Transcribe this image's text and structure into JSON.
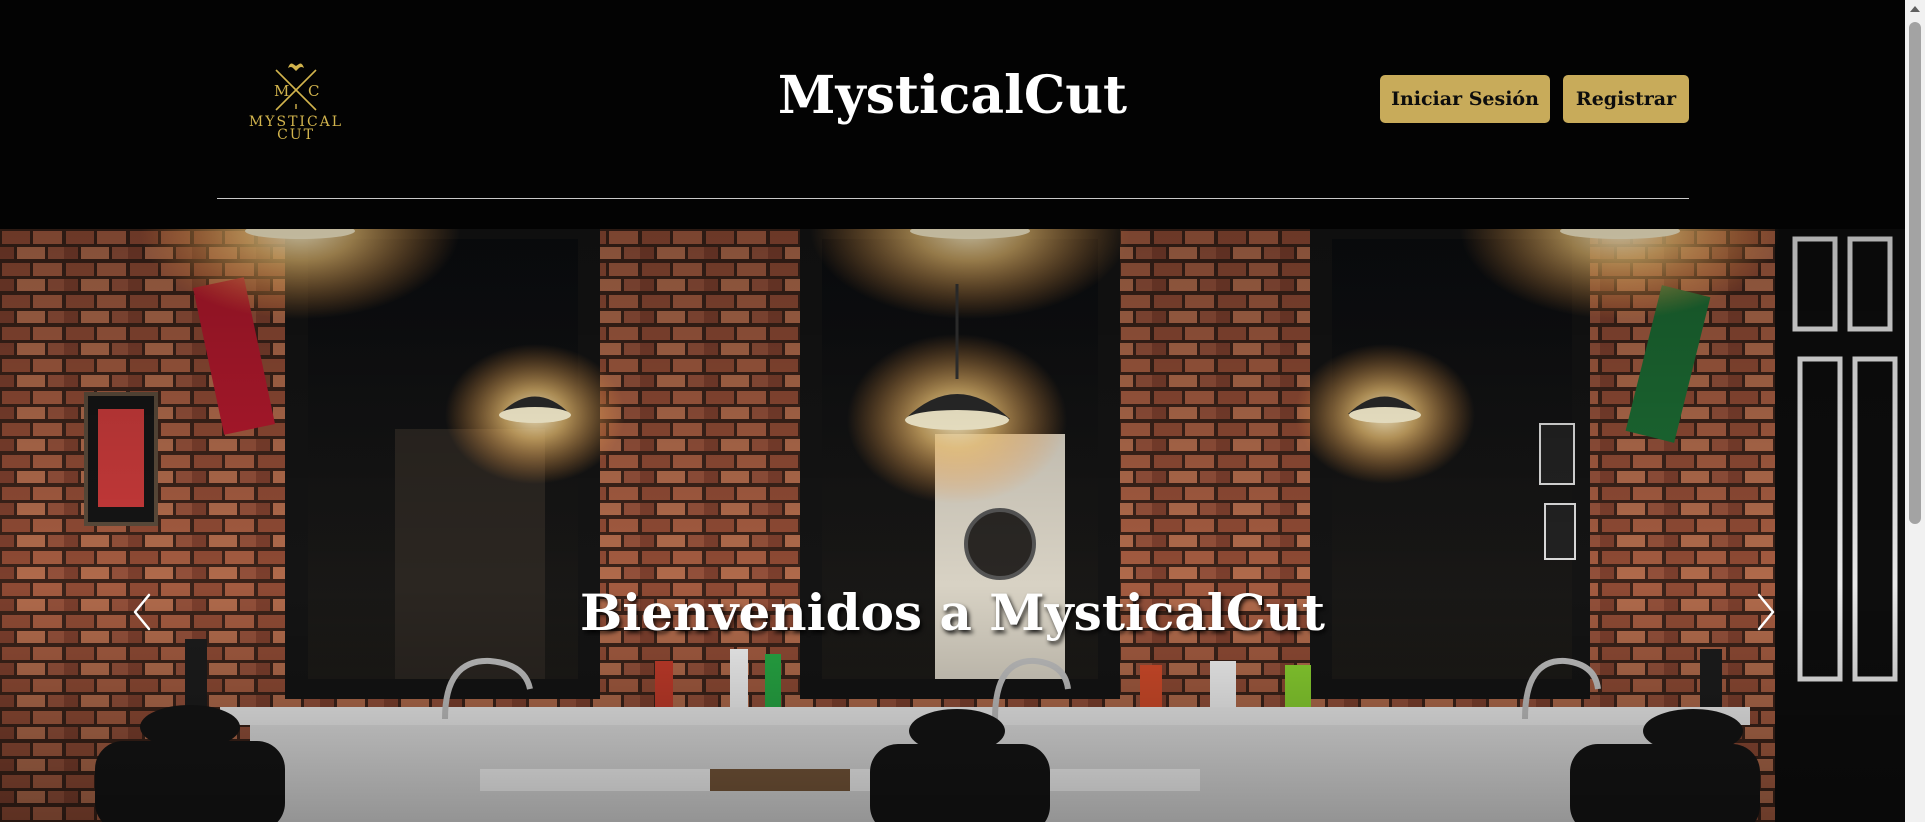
{
  "header": {
    "logo": {
      "monogram_left": "M",
      "monogram_right": "C",
      "line1": "MYSTICAL",
      "line2": "CUT",
      "color": "#d2b44d",
      "icon": "crossed-razors-bull-icon"
    },
    "site_title": "MysticalCut",
    "login_label": "Iniciar Sesión",
    "register_label": "Registrar",
    "button_color": "#c8ab5a"
  },
  "hero": {
    "title": "Bienvenidos a MysticalCut",
    "prev_icon": "chevron-left-icon",
    "next_icon": "chevron-right-icon",
    "image": "barbershop-interior"
  },
  "scrollbar": {
    "up_icon": "triangle-up-icon"
  }
}
